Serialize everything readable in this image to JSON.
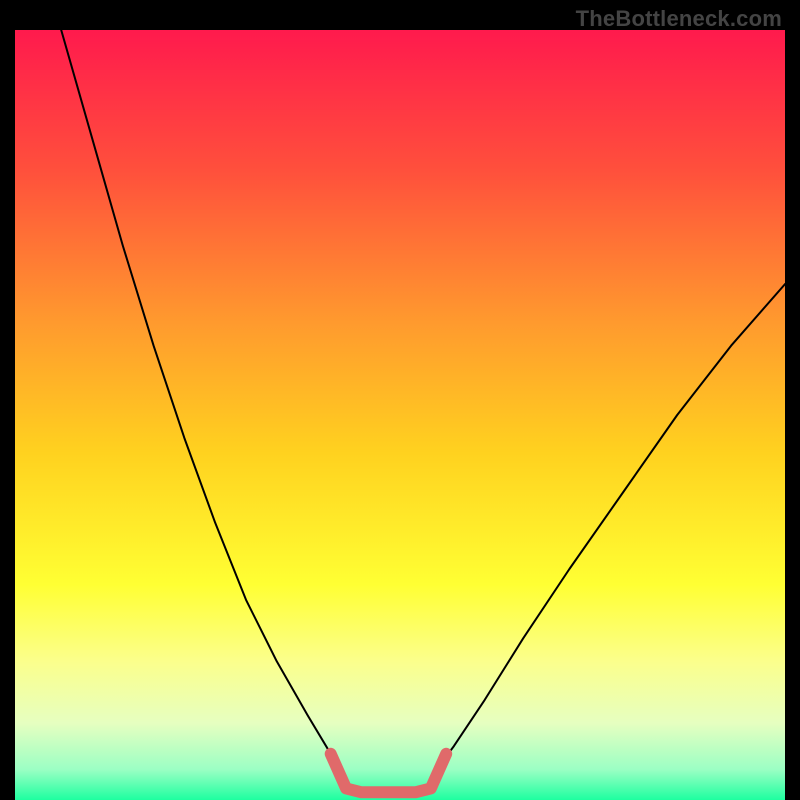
{
  "watermark": "TheBottleneck.com",
  "chart_data": {
    "type": "line",
    "title": "",
    "xlabel": "",
    "ylabel": "",
    "xlim": [
      0,
      100
    ],
    "ylim": [
      0,
      100
    ],
    "grid": false,
    "legend": false,
    "background_gradient": {
      "stops": [
        {
          "t": 0.0,
          "color": "#ff1a4d"
        },
        {
          "t": 0.18,
          "color": "#ff4f3c"
        },
        {
          "t": 0.38,
          "color": "#ff9a2e"
        },
        {
          "t": 0.55,
          "color": "#ffd21f"
        },
        {
          "t": 0.72,
          "color": "#ffff33"
        },
        {
          "t": 0.82,
          "color": "#fbff8c"
        },
        {
          "t": 0.9,
          "color": "#e6ffc0"
        },
        {
          "t": 0.96,
          "color": "#9cffc4"
        },
        {
          "t": 1.0,
          "color": "#1effa0"
        }
      ]
    },
    "series": [
      {
        "name": "left-curve",
        "stroke": "#000000",
        "stroke_width": 2,
        "x": [
          6,
          10,
          14,
          18,
          22,
          26,
          30,
          34,
          38,
          41,
          43
        ],
        "y": [
          100,
          86,
          72,
          59,
          47,
          36,
          26,
          18,
          11,
          6,
          3
        ]
      },
      {
        "name": "right-curve",
        "stroke": "#000000",
        "stroke_width": 2,
        "x": [
          54,
          57,
          61,
          66,
          72,
          79,
          86,
          93,
          100
        ],
        "y": [
          3,
          7,
          13,
          21,
          30,
          40,
          50,
          59,
          67
        ]
      },
      {
        "name": "bottom-bracket",
        "stroke": "#e06a6a",
        "stroke_width": 12,
        "x": [
          41,
          43,
          45,
          52,
          54,
          56
        ],
        "y": [
          6,
          1.5,
          1,
          1,
          1.5,
          6
        ]
      }
    ]
  }
}
